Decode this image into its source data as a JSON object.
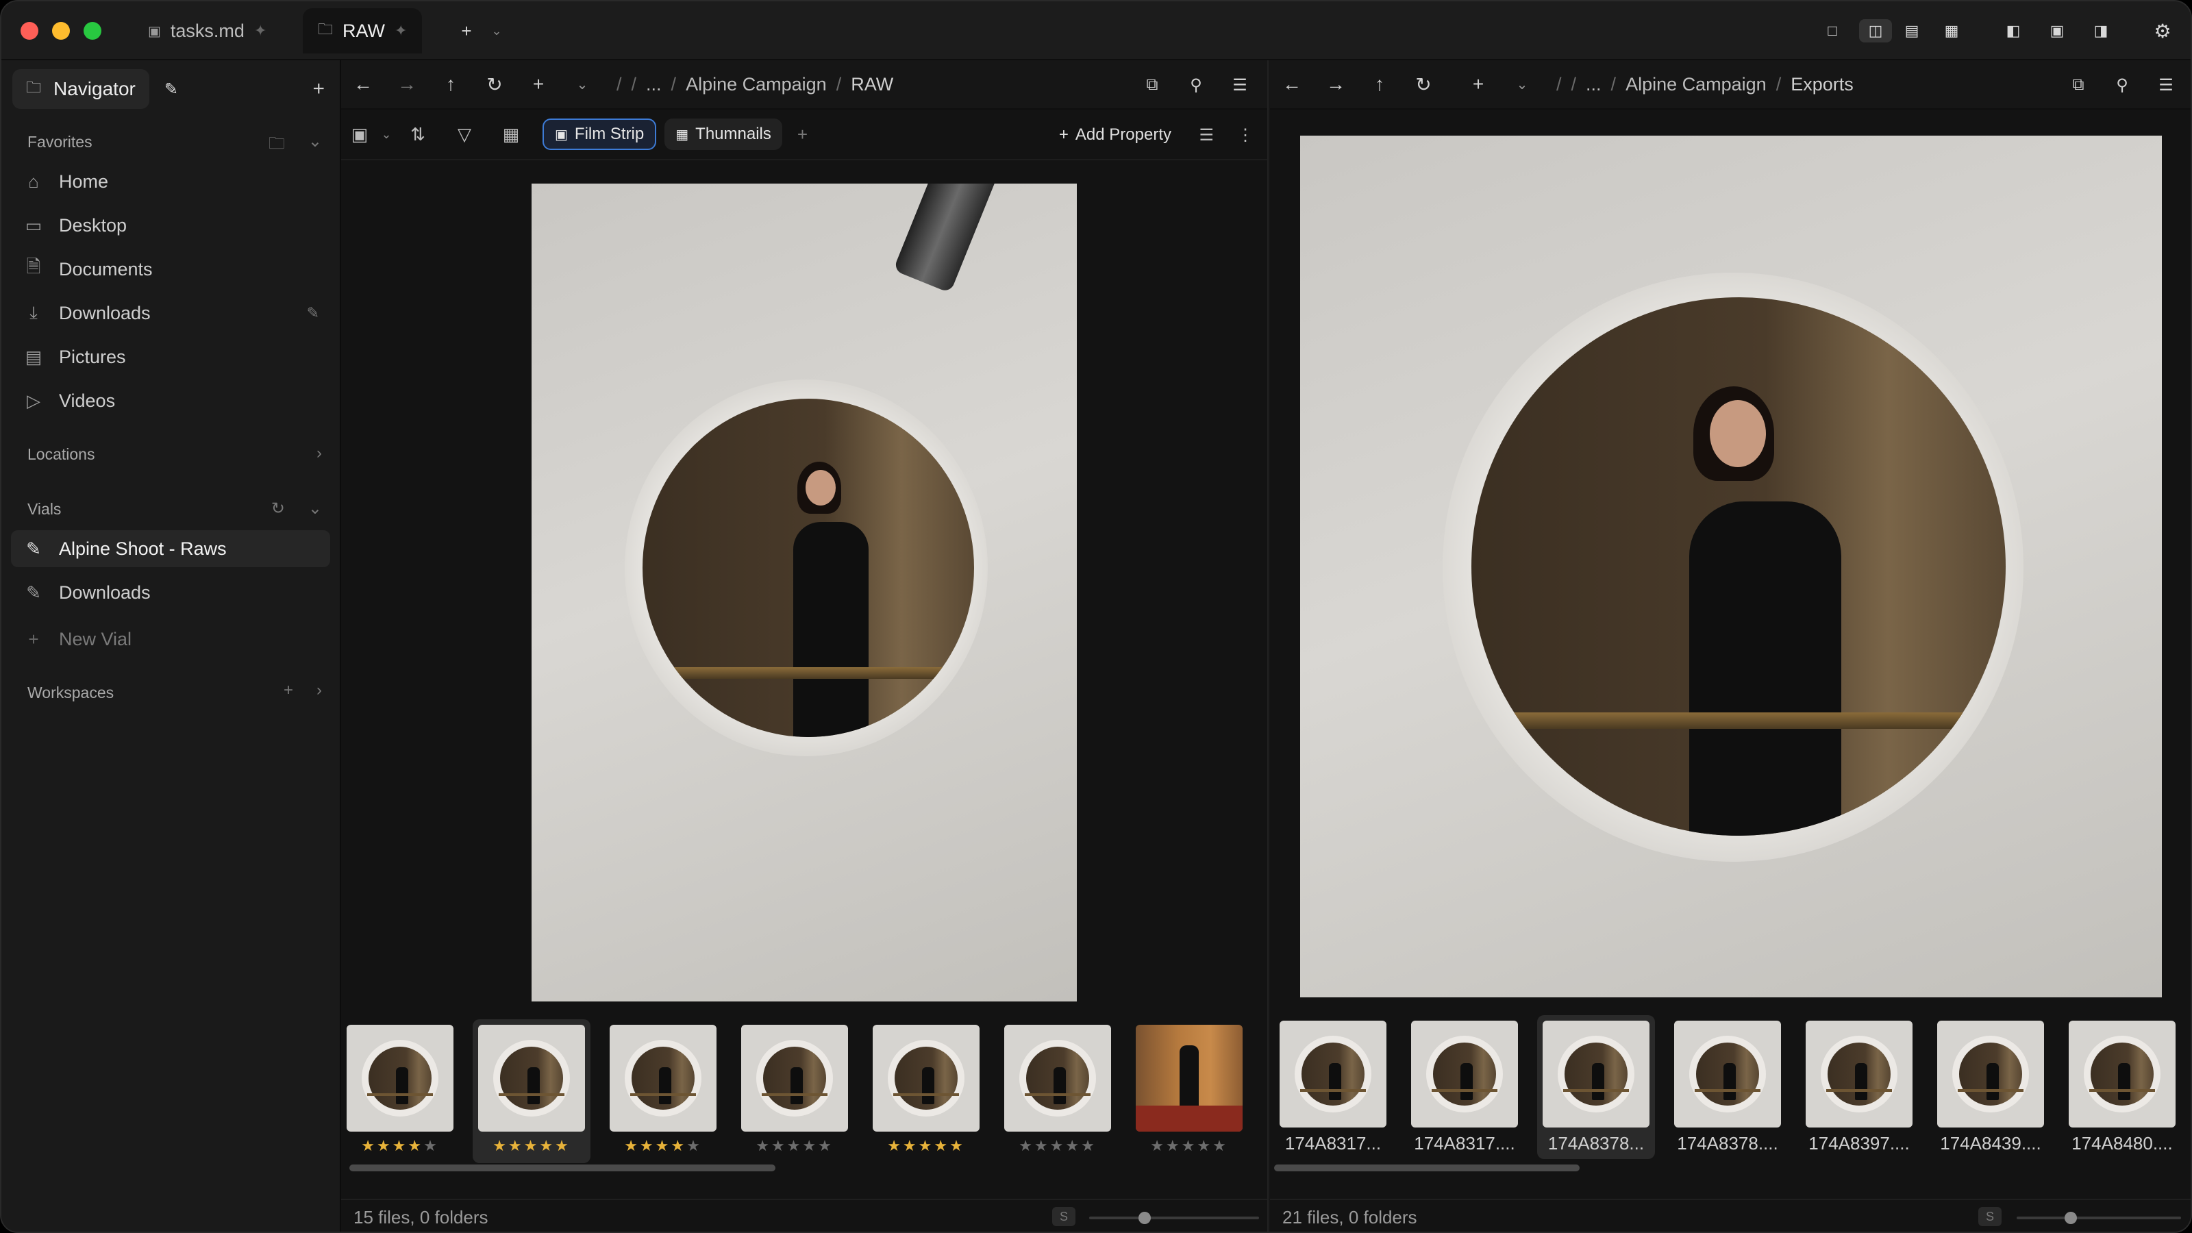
{
  "tabs": [
    {
      "label": "tasks.md",
      "icon": "markdown-file-icon"
    },
    {
      "label": "RAW",
      "icon": "folder-icon"
    }
  ],
  "sidebar": {
    "navigator_label": "Navigator",
    "favorites_title": "Favorites",
    "favorites": [
      {
        "label": "Home",
        "icon": "home-icon"
      },
      {
        "label": "Desktop",
        "icon": "desktop-icon"
      },
      {
        "label": "Documents",
        "icon": "document-icon"
      },
      {
        "label": "Downloads",
        "icon": "download-icon"
      },
      {
        "label": "Pictures",
        "icon": "picture-icon"
      },
      {
        "label": "Videos",
        "icon": "video-icon"
      }
    ],
    "locations_title": "Locations",
    "vials_title": "Vials",
    "vials": [
      {
        "label": "Alpine Shoot - Raws",
        "selected": true
      },
      {
        "label": "Downloads",
        "selected": false
      }
    ],
    "new_vial": "New Vial",
    "workspaces_title": "Workspaces"
  },
  "left_pane": {
    "crumbs": [
      "/",
      "/",
      "...",
      "/",
      "Alpine Campaign",
      "/",
      "RAW"
    ],
    "view_chips": [
      "Film Strip",
      "Thumnails"
    ],
    "add_property": "Add Property",
    "ratings": [
      4,
      5,
      4,
      0,
      5,
      0,
      0
    ],
    "status": "15 files, 0 folders",
    "size_badge": "S"
  },
  "right_pane": {
    "crumbs": [
      "/",
      "/",
      "...",
      "/",
      "Alpine Campaign",
      "/",
      "Exports"
    ],
    "thumb_names": [
      "174A8317...",
      "174A8317....",
      "174A8378...",
      "174A8378....",
      "174A8397....",
      "174A8439....",
      "174A8480...."
    ],
    "status": "21 files, 0 folders",
    "size_badge": "S"
  },
  "colors": {
    "star_on": "#e8b33a",
    "star_off": "#6d6d6d",
    "accent": "#3d7bd6"
  }
}
